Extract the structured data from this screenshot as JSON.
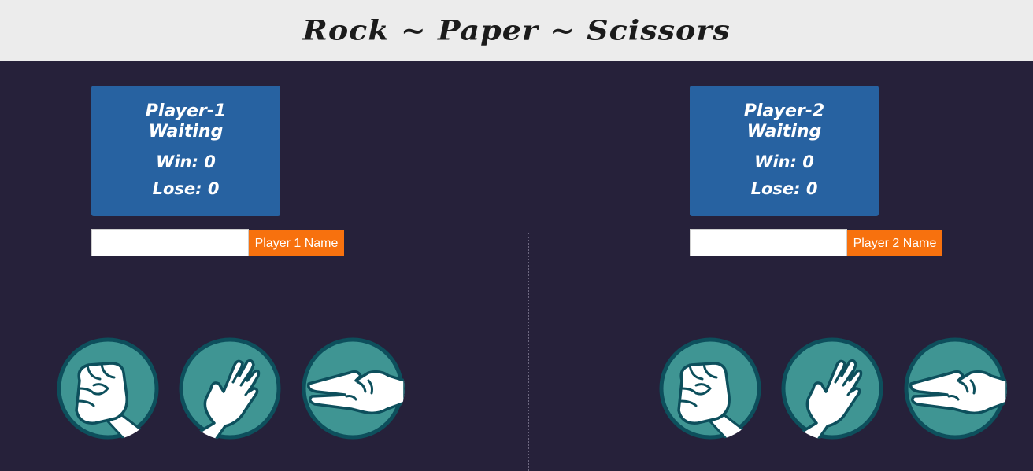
{
  "header": {
    "title": "Rock ~ Paper ~ Scissors"
  },
  "players": [
    {
      "name": "Player-1",
      "status": "Waiting",
      "win_text": "Win: 0",
      "lose_text": "Lose: 0",
      "input_value": "",
      "button_label": "Player 1 Name",
      "choices": [
        "rock-icon",
        "paper-icon",
        "scissors-icon"
      ]
    },
    {
      "name": "Player-2",
      "status": "Waiting",
      "win_text": "Win: 0",
      "lose_text": "Lose: 0",
      "input_value": "",
      "button_label": "Player 2 Name",
      "choices": [
        "rock-icon",
        "paper-icon",
        "scissors-icon"
      ]
    }
  ],
  "colors": {
    "background": "#26213a",
    "header": "#ececec",
    "card": "#2762a1",
    "button": "#f7710e",
    "choice_fill": "#3f9593",
    "choice_ring": "#0d4f5c"
  }
}
